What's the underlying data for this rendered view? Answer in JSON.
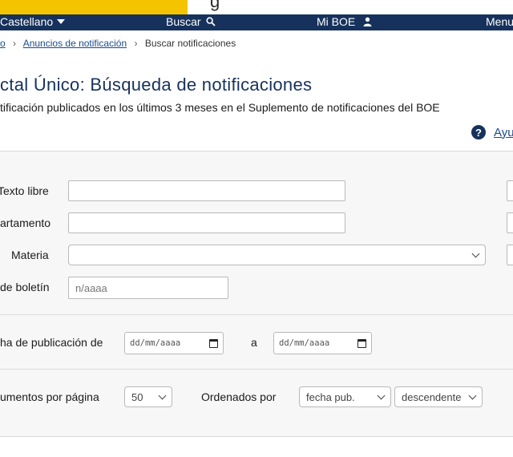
{
  "header": {
    "ghost_text": "g"
  },
  "navbar": {
    "language": "Castellano",
    "search": "Buscar",
    "mi_boe": "Mi BOE",
    "menu": "Menu"
  },
  "breadcrumb": {
    "first": "o",
    "second": "Anuncios de notificación",
    "current": "Buscar notificaciones"
  },
  "page": {
    "title": "ctal Único: Búsqueda de notificaciones",
    "subtitle": "tificación publicados en los últimos 3 meses en el Suplemento de notificaciones del BOE",
    "help_label": "Ayu",
    "help_symbol": "?"
  },
  "form": {
    "texto_libre_label": "Texto libre",
    "departamento_label": "artamento",
    "materia_label": "Materia",
    "boletin_label": "de boletín",
    "boletin_placeholder": "n/aaaa",
    "fecha_label": "ha de publicación de",
    "fecha_a_label": "a",
    "date_from_placeholder": "dd/mm/aaaa",
    "date_to_placeholder": "dd/mm/aaaa",
    "docs_label": "umentos por página",
    "docs_value": "50",
    "ordenados_label": "Ordenados por",
    "order_field_value": "fecha pub.",
    "order_dir_value": "descendente"
  },
  "colors": {
    "navbar": "#16325c",
    "brand_yellow": "#f5c400",
    "link": "#1b4a8b",
    "panel_bg": "#f7f7f7"
  }
}
